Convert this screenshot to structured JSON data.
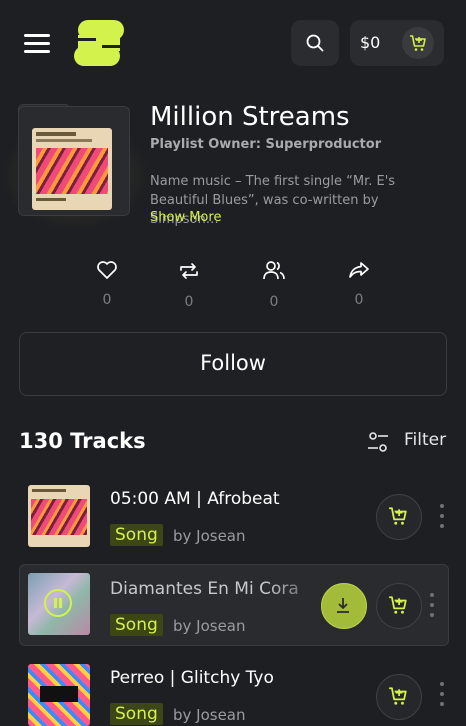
{
  "header": {
    "menu_icon": "hamburger-icon",
    "logo_icon": "s-logo-icon",
    "search_icon": "search-icon",
    "cart_amount": "$0",
    "cart_icon": "cart-plus-icon",
    "accent": "#d4f24c"
  },
  "playlist": {
    "title": "Million Streams",
    "owner": "Playlist Owner: Superproductor",
    "description": "Name music – The first single “Mr. E's Beautiful Blues”, was co-written by Simpson…",
    "show_more": "Show More",
    "stats": [
      {
        "icon": "heart-icon",
        "count": "0"
      },
      {
        "icon": "repost-icon",
        "count": "0"
      },
      {
        "icon": "users-icon",
        "count": "0"
      },
      {
        "icon": "share-icon",
        "count": "0"
      }
    ],
    "follow_label": "Follow"
  },
  "tracks": {
    "count_label": "130 Tracks",
    "filter_label": "Filter",
    "items": [
      {
        "title": "05:00 AM | Afrobeat",
        "badge": "Song",
        "artist": "by Josean"
      },
      {
        "title": "Diamantes En Mi Cora",
        "badge": "Song",
        "artist": "by Josean",
        "playing": true
      },
      {
        "title": "Perreo | Glitchy Tyo",
        "badge": "Song",
        "artist": "by Josean"
      }
    ]
  }
}
